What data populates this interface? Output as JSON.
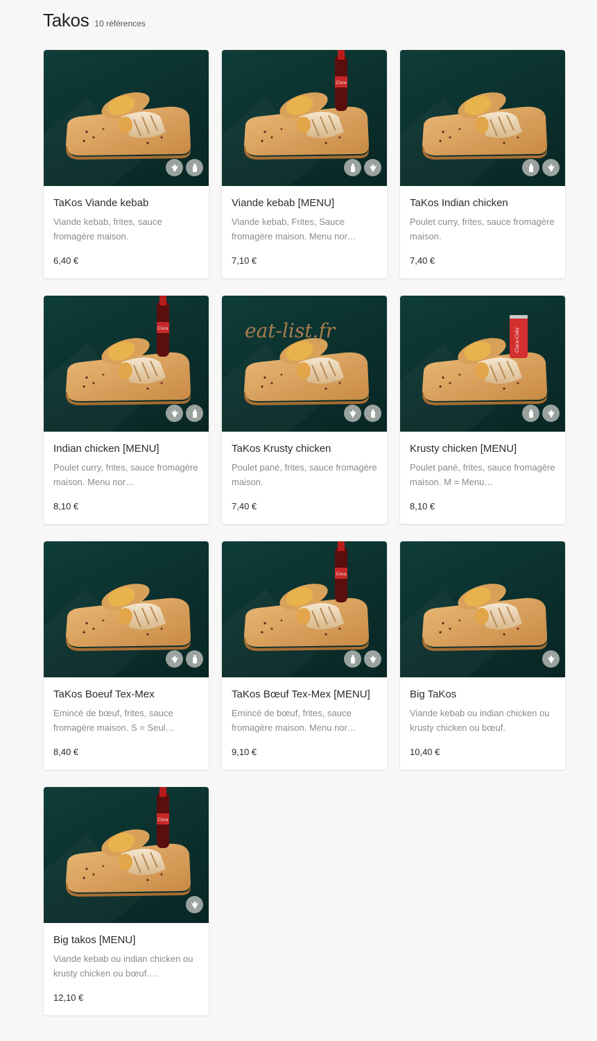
{
  "category": {
    "title": "Takos",
    "count_label": "10 références"
  },
  "watermark": "eat-list.fr",
  "colors": {
    "card_photo_bg": "#0f3d38",
    "badge_bg": "#9aa39f",
    "price_text": "#2b2b2b",
    "desc_text": "#8a8a8a"
  },
  "products": [
    {
      "name": "TaKos Viande kebab",
      "description": "Viande kebab, frites, sauce fromagère maison.",
      "price": "6,40 €",
      "drink": "none",
      "badges": [
        "halal-icon",
        "bottle-icon"
      ]
    },
    {
      "name": "Viande kebab [MENU]",
      "description": "Viande kebab, Frites, Sauce fromagère maison. Menu nor…",
      "price": "7,10 €",
      "drink": "bottle",
      "badges": [
        "bottle-icon",
        "halal-icon"
      ]
    },
    {
      "name": "TaKos Indian chicken",
      "description": "Poulet curry, frites, sauce fromagère maison.",
      "price": "7,40 €",
      "drink": "none",
      "badges": [
        "bottle-icon",
        "halal-icon"
      ]
    },
    {
      "name": "Indian chicken [MENU]",
      "description": "Poulet curry, frites, sauce fromagère maison. Menu nor…",
      "price": "8,10 €",
      "drink": "bottle",
      "badges": [
        "halal-icon",
        "bottle-icon"
      ]
    },
    {
      "name": "TaKos Krusty chicken",
      "description": "Poulet pané, frites, sauce fromagère maison.",
      "price": "7,40 €",
      "drink": "none",
      "badges": [
        "halal-icon",
        "bottle-icon"
      ]
    },
    {
      "name": "Krusty chicken [MENU]",
      "description": "Poulet pané, frites, sauce fromagère maison. M = Menu…",
      "price": "8,10 €",
      "drink": "can",
      "badges": [
        "bottle-icon",
        "halal-icon"
      ]
    },
    {
      "name": "TaKos Boeuf Tex-Mex",
      "description": "Emincé de bœuf, frites, sauce fromagère maison. S = Seul…",
      "price": "8,40 €",
      "drink": "none",
      "badges": [
        "halal-icon",
        "bottle-icon"
      ]
    },
    {
      "name": "TaKos Bœuf Tex-Mex [MENU]",
      "description": "Emincé de bœuf, frites, sauce fromagère maison. Menu nor…",
      "price": "9,10 €",
      "drink": "bottle",
      "badges": [
        "bottle-icon",
        "halal-icon"
      ]
    },
    {
      "name": "Big TaKos",
      "description": "Viande kebab ou indian chicken ou krusty chicken ou bœuf.",
      "price": "10,40 €",
      "drink": "none",
      "badges": [
        "halal-icon"
      ]
    },
    {
      "name": "Big takos [MENU]",
      "description": "Viande kebab ou indian chicken ou krusty chicken ou bœuf.…",
      "price": "12,10 €",
      "drink": "bottle",
      "badges": [
        "halal-icon"
      ]
    }
  ]
}
